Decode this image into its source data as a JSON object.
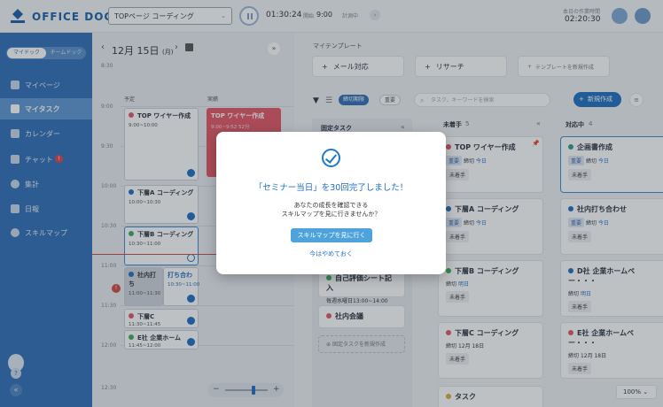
{
  "header": {
    "logo_text": "OFFICE DOCK",
    "task_select": "TOPページ コーディング",
    "timer": "01:30:24",
    "start_label": "開始",
    "start_time": "9:00",
    "measuring_label": "計測中",
    "today_label": "本日の作業時間",
    "today_time": "02:20:30"
  },
  "sidebar": {
    "toggle_on": "マイドック",
    "toggle_off": "チームドック",
    "items": [
      {
        "label": "マイページ"
      },
      {
        "label": "マイタスク"
      },
      {
        "label": "カレンダー"
      },
      {
        "label": "チャット",
        "badge": "!"
      },
      {
        "label": "集計"
      },
      {
        "label": "日報"
      },
      {
        "label": "スキルマップ"
      }
    ]
  },
  "calendar": {
    "date": "12月 15日",
    "weekday": "(月)",
    "col_plan": "予定",
    "col_actual": "実績",
    "times": [
      "8:30",
      "9:00",
      "9:30",
      "10:00",
      "10:30",
      "11:00",
      "11:30",
      "12:00",
      "12:30"
    ],
    "events": [
      {
        "title": "TOP ワイヤー作成",
        "time": "9:00~10:00"
      },
      {
        "title": "TOP ワイヤー作成",
        "time": "9:00~9:52  52分"
      },
      {
        "title": "下層A コーディング",
        "time": "10:00~10:30"
      },
      {
        "title": "下層B コーディング",
        "time": "10:30~11:00"
      },
      {
        "title": "社内打ち",
        "time": "11:00~11:30"
      },
      {
        "title": "打ち合わ",
        "time": "10:30~11:00"
      },
      {
        "title": "下層C",
        "time": "11:30~11:45"
      },
      {
        "title": "E社 企業ホーム",
        "time": "11:45~12:00"
      }
    ]
  },
  "templates": {
    "label": "マイテンプレート",
    "items": [
      "メール対応",
      "リサーチ"
    ],
    "new": "テンプレートを新規作成"
  },
  "toolbar": {
    "filter_on": "締切期限",
    "filter_off": "重要",
    "search_placeholder": "タスク、キーワードを検索",
    "new_button": "新規作成"
  },
  "columns": {
    "fixed": {
      "title": "固定タスク",
      "items": [
        {
          "title": "自己評価シート記入",
          "sub": "毎週水曜日13:00~14:00"
        },
        {
          "title": "社内会議"
        }
      ],
      "new": "固定タスクを新規作成"
    },
    "todo": {
      "title": "未着手",
      "count": "5",
      "items": [
        {
          "title": "TOP ワイヤー作成",
          "tag": "重要",
          "due": "締切",
          "due_val": "今日",
          "status": "未着手",
          "color": "#e25663"
        },
        {
          "title": "下層A コーディング",
          "tag": "重要",
          "due": "締切",
          "due_val": "今日",
          "status": "未着手",
          "color": "#1f6fc2"
        },
        {
          "title": "下層B コーディング",
          "due": "締切",
          "due_val": "明日",
          "status": "未着手",
          "color": "#3cae5a"
        },
        {
          "title": "下層C コーディング",
          "due": "締切",
          "due_val": "12月 18日",
          "status": "未着手",
          "color": "#e25663"
        },
        {
          "title": "タスク",
          "color": "#e0a73c"
        }
      ]
    },
    "doing": {
      "title": "対応中",
      "count": "4",
      "items": [
        {
          "title": "企画書作成",
          "tag": "重要",
          "due": "締切",
          "due_val": "今日",
          "status": "未着手",
          "color": "#2a9d8f"
        },
        {
          "title": "社内打ち合わせ",
          "tag": "重要",
          "due": "締切",
          "due_val": "今日",
          "status": "未着手",
          "color": "#1f6fc2"
        },
        {
          "title": "D社 企業ホームペー・・・",
          "due": "締切",
          "due_val": "明日",
          "status": "未着手",
          "color": "#1f6fc2"
        },
        {
          "title": "E社 企業ホームペー・・・",
          "due": "締切",
          "due_val": "12月 18日",
          "status": "未着手",
          "color": "#e25663"
        }
      ]
    }
  },
  "zoom": "100%",
  "modal": {
    "title": "「セミナー当日」を30回完了しました！",
    "message_line1": "あなたの成長を確認できる",
    "message_line2": "スキルマップを見に行きませんか？",
    "cta": "スキルマップを見に行く",
    "skip": "今はやめておく"
  }
}
